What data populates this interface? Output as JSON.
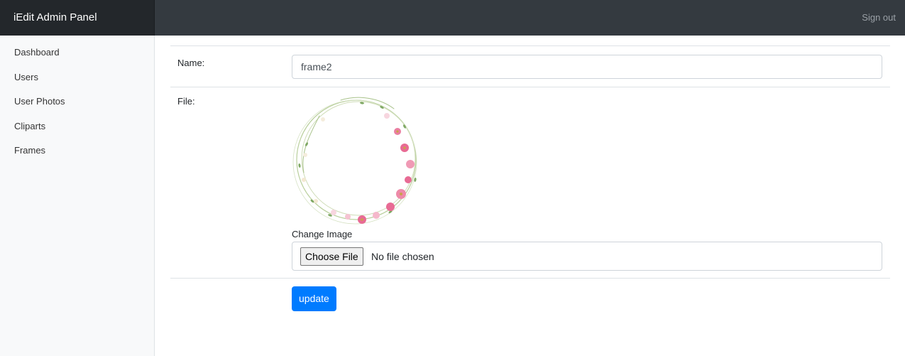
{
  "header": {
    "brand": "iEdit Admin Panel",
    "signout_label": "Sign out"
  },
  "sidebar": {
    "items": [
      {
        "label": "Dashboard"
      },
      {
        "label": "Users"
      },
      {
        "label": "User Photos"
      },
      {
        "label": "Cliparts"
      },
      {
        "label": "Frames"
      }
    ]
  },
  "form": {
    "name_label": "Name:",
    "name_value": "frame2",
    "file_label": "File:",
    "change_image_label": "Change Image",
    "choose_file_label": "Choose File",
    "no_file_text": "No file chosen",
    "update_label": "update"
  },
  "colors": {
    "topbar": "#343a40",
    "brand_bg": "#23272b",
    "primary": "#007bff",
    "sidebar_bg": "#f8f9fa"
  },
  "icons": {
    "frame_preview": "floral-wreath-frame-image"
  }
}
